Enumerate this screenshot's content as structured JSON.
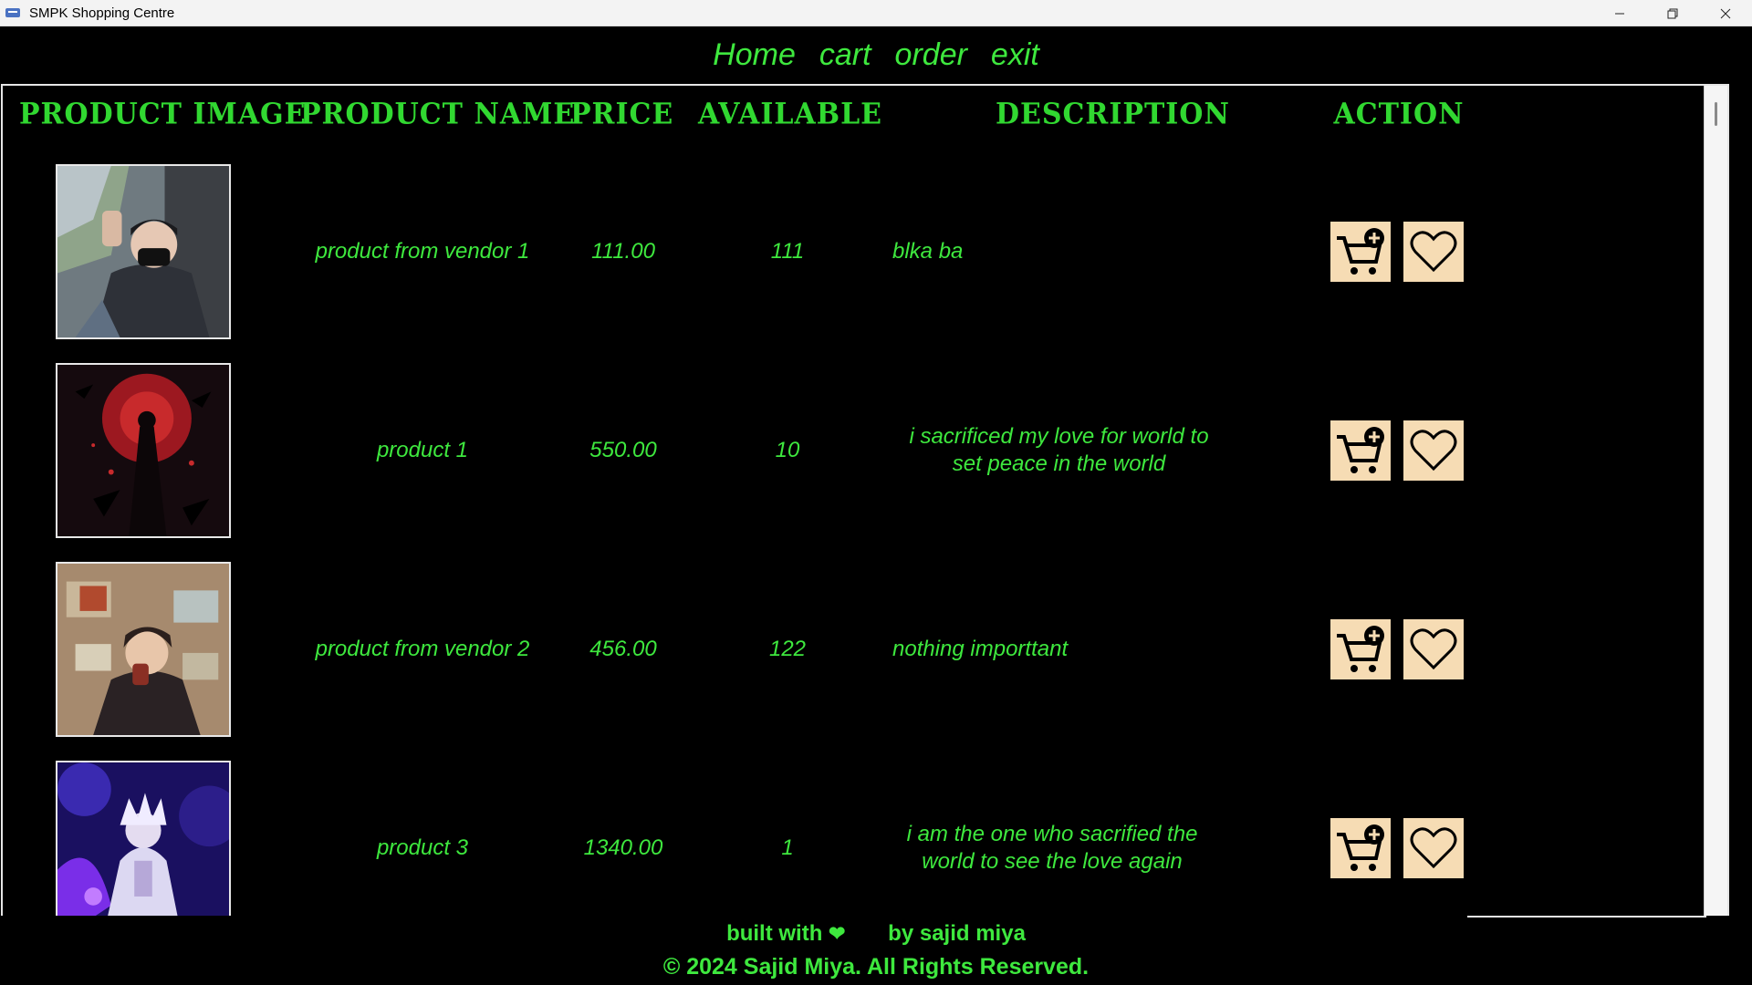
{
  "window": {
    "title": "SMPK Shopping Centre"
  },
  "nav": {
    "items": [
      "Home",
      "cart",
      "order",
      "exit"
    ]
  },
  "table": {
    "headers": [
      "Product Image",
      "Product Name",
      "Price",
      "Available",
      "Description",
      "Action"
    ],
    "rows": [
      {
        "name": "product from vendor 1",
        "price": "111.00",
        "available": "111",
        "description": "blka ba",
        "image": "selfie-portrait"
      },
      {
        "name": "product 1",
        "price": "550.00",
        "available": "10",
        "description": "i sacrificed my love for world to set peace in the world",
        "image": "red-moon-anime"
      },
      {
        "name": "product from vendor 2",
        "price": "456.00",
        "available": "122",
        "description": "nothing importtant",
        "image": "anime-boy-room"
      },
      {
        "name": "product 3",
        "price": "1340.00",
        "available": "1",
        "description": "i am the one who sacrified the world to see the love again",
        "image": "purple-anime-warrior"
      }
    ],
    "actions": {
      "add_icon": "add-to-cart-icon",
      "wish_icon": "heart-icon"
    }
  },
  "footer": {
    "built_with": "built with",
    "by": "by sajid miya",
    "copyright": "© 2024 Sajid Miya. All Rights Reserved."
  },
  "colors": {
    "accent": "#3ee83e",
    "action_bg": "#f6dcb4",
    "background": "#000000"
  }
}
